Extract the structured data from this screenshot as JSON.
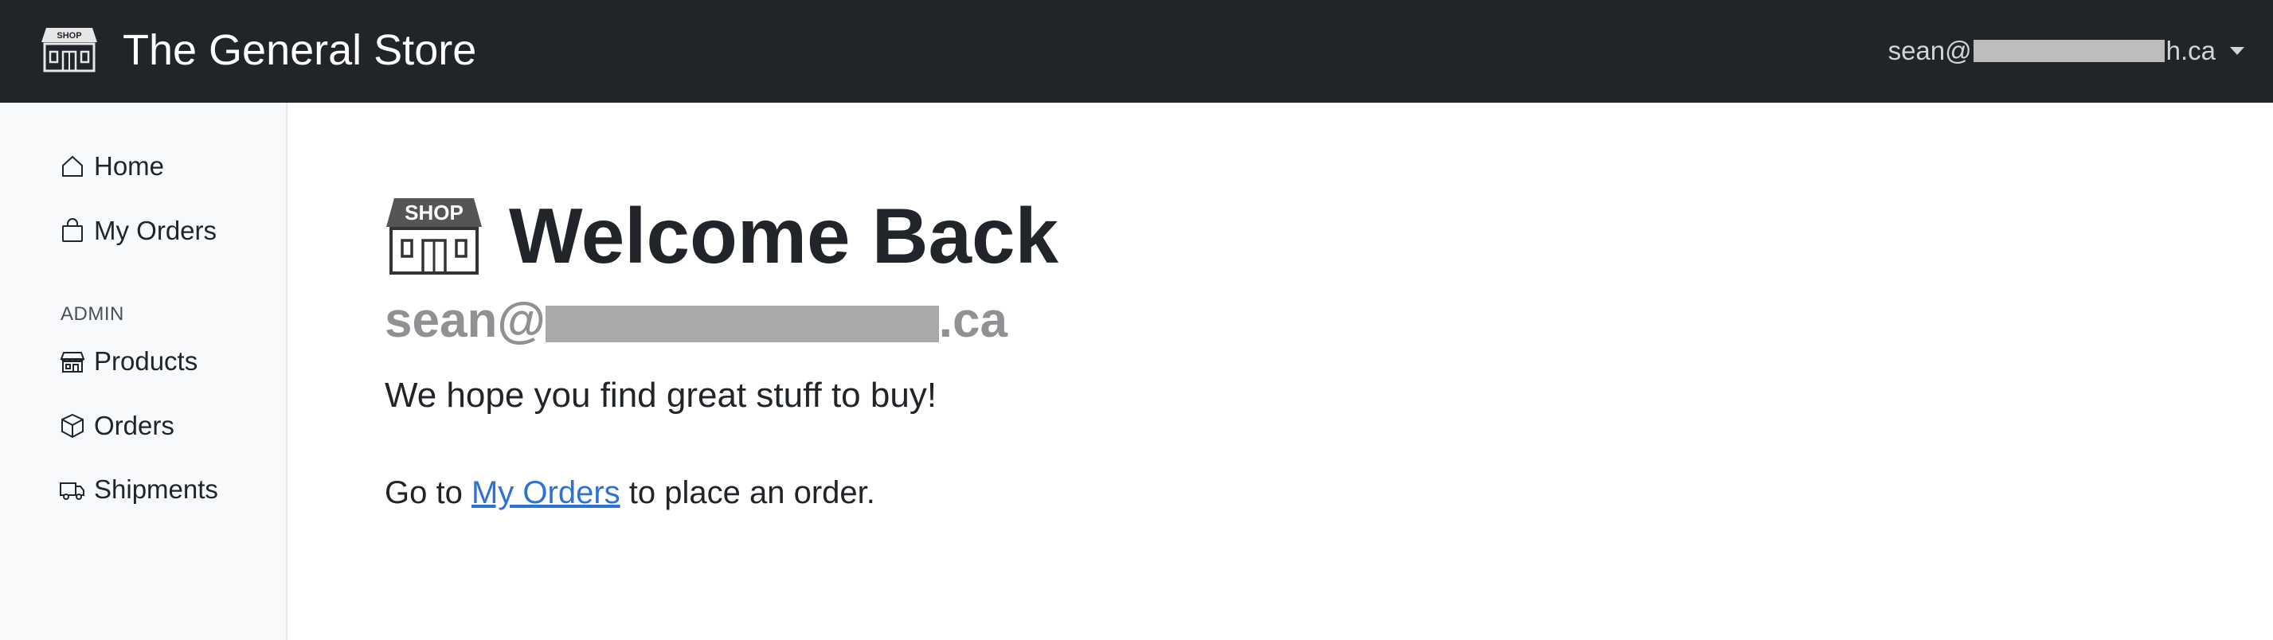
{
  "header": {
    "brand_icon_text": "SHOP",
    "brand_title": "The General Store",
    "user": {
      "email_prefix": "sean@",
      "email_suffix": "h.ca"
    }
  },
  "sidebar": {
    "items": [
      {
        "label": "Home",
        "icon": "house-icon"
      },
      {
        "label": "My Orders",
        "icon": "bag-icon"
      }
    ],
    "admin_label": "ADMIN",
    "admin_items": [
      {
        "label": "Products",
        "icon": "shop-icon"
      },
      {
        "label": "Orders",
        "icon": "box-icon"
      },
      {
        "label": "Shipments",
        "icon": "truck-icon"
      }
    ]
  },
  "main": {
    "hero_icon_text": "SHOP",
    "title": "Welcome Back",
    "email_prefix": "sean@",
    "email_suffix": ".ca",
    "tagline": "We hope you find great stuff to buy!",
    "cta_prefix": "Go to ",
    "cta_link": "My Orders",
    "cta_suffix": " to place an order."
  },
  "colors": {
    "topbar": "#212529",
    "sidebar": "#f8f9fa",
    "link": "#2f72d6",
    "muted_email": "#8f9194"
  }
}
